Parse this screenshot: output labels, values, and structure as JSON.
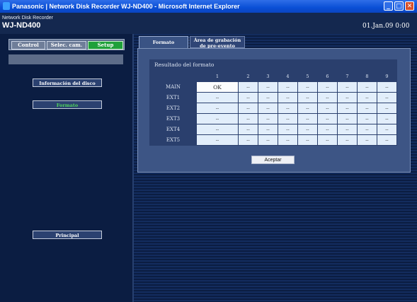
{
  "window": {
    "title": "Panasonic  |  Network Disk Recorder WJ-ND400 - Microsoft Internet Explorer",
    "minimize_glyph": "_",
    "maximize_glyph": "□",
    "close_glyph": "✕"
  },
  "header": {
    "product_line": "Network Disk Recorder",
    "model": "WJ-ND400",
    "datetime": "01.Jan.09  0:00"
  },
  "nav": {
    "items": [
      "Control",
      "Selec. cam.",
      "Setup"
    ],
    "active": "Setup"
  },
  "sidebar": {
    "buttons": [
      "Información del disco",
      "Formato",
      "Principal"
    ],
    "active": "Formato"
  },
  "tabs": {
    "items": [
      "Formato",
      "Área de grabación de pre-evento"
    ],
    "active": "Formato"
  },
  "results": {
    "title": "Resultado del formato",
    "columns": [
      "1",
      "2",
      "3",
      "4",
      "5",
      "6",
      "7",
      "8",
      "9"
    ],
    "rows": [
      {
        "label": "MAIN",
        "values": [
          "OK",
          "--",
          "--",
          "--",
          "--",
          "--",
          "--",
          "--",
          "--"
        ]
      },
      {
        "label": "EXT1",
        "values": [
          "--",
          "--",
          "--",
          "--",
          "--",
          "--",
          "--",
          "--",
          "--"
        ]
      },
      {
        "label": "EXT2",
        "values": [
          "--",
          "--",
          "--",
          "--",
          "--",
          "--",
          "--",
          "--",
          "--"
        ]
      },
      {
        "label": "EXT3",
        "values": [
          "--",
          "--",
          "--",
          "--",
          "--",
          "--",
          "--",
          "--",
          "--"
        ]
      },
      {
        "label": "EXT4",
        "values": [
          "--",
          "--",
          "--",
          "--",
          "--",
          "--",
          "--",
          "--",
          "--"
        ]
      },
      {
        "label": "EXT5",
        "values": [
          "--",
          "--",
          "--",
          "--",
          "--",
          "--",
          "--",
          "--",
          "--"
        ]
      }
    ]
  },
  "accept_label": "Aceptar",
  "colors": {
    "setup_active": "#1fa03a",
    "formato_active_text": "#4fd65a",
    "background": "#0d1f47"
  }
}
